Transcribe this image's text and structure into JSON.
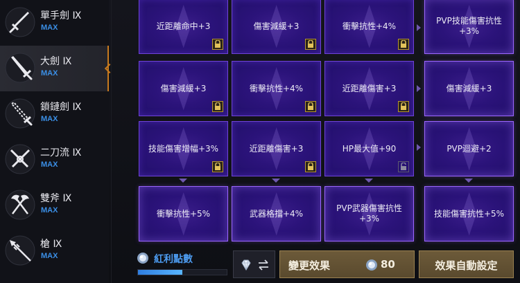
{
  "weapons": [
    {
      "name": "單手劍 Ⅸ",
      "level": "MAX",
      "icon": "one-handed-sword-icon"
    },
    {
      "name": "大劍 Ⅸ",
      "level": "MAX",
      "icon": "greatsword-icon"
    },
    {
      "name": "鎖鏈劍 Ⅸ",
      "level": "MAX",
      "icon": "chain-sword-icon"
    },
    {
      "name": "二刀流 Ⅸ",
      "level": "MAX",
      "icon": "dual-blades-icon"
    },
    {
      "name": "雙斧 Ⅸ",
      "level": "MAX",
      "icon": "double-axe-icon"
    },
    {
      "name": "槍 Ⅸ",
      "level": "MAX",
      "icon": "spear-icon"
    }
  ],
  "selected_weapon": 1,
  "effects": [
    [
      {
        "text": "近距離命中+3",
        "locked": true
      },
      {
        "text": "傷害減緩+3",
        "locked": true
      },
      {
        "text": "衝擊抗性+4%",
        "locked": true
      },
      {
        "text": "PVP技能傷害抗性\n+3%",
        "locked": false
      }
    ],
    [
      {
        "text": "傷害減緩+3",
        "locked": true
      },
      {
        "text": "衝擊抗性+4%",
        "locked": true
      },
      {
        "text": "近距離傷害+3",
        "locked": true
      },
      {
        "text": "傷害減緩+3",
        "locked": false
      }
    ],
    [
      {
        "text": "技能傷害增幅+3%",
        "locked": true
      },
      {
        "text": "近距離傷害+3",
        "locked": true
      },
      {
        "text": "HP最大值+90",
        "locked": false,
        "lock_open": true
      },
      {
        "text": "PVP迴避+2",
        "locked": false
      }
    ],
    [
      {
        "text": "衝擊抗性+5%",
        "locked": false
      },
      {
        "text": "武器格擋+4%",
        "locked": false
      },
      {
        "text": "PVP武器傷害抗性\n+3%",
        "locked": false
      },
      {
        "text": "技能傷害抗性+5%",
        "locked": false
      }
    ]
  ],
  "bonus": {
    "label": "紅利點數",
    "progress": 0.5
  },
  "buttons": {
    "change_label": "變更效果",
    "change_cost": "80",
    "auto_label": "效果自動設定",
    "swap_icons": [
      "diamond-icon",
      "swap-arrows-icon"
    ]
  },
  "colors": {
    "accent": "#3b8fe6",
    "selected": "#c87a1e",
    "card": "#2b137a",
    "gold": "#6c5a39"
  }
}
